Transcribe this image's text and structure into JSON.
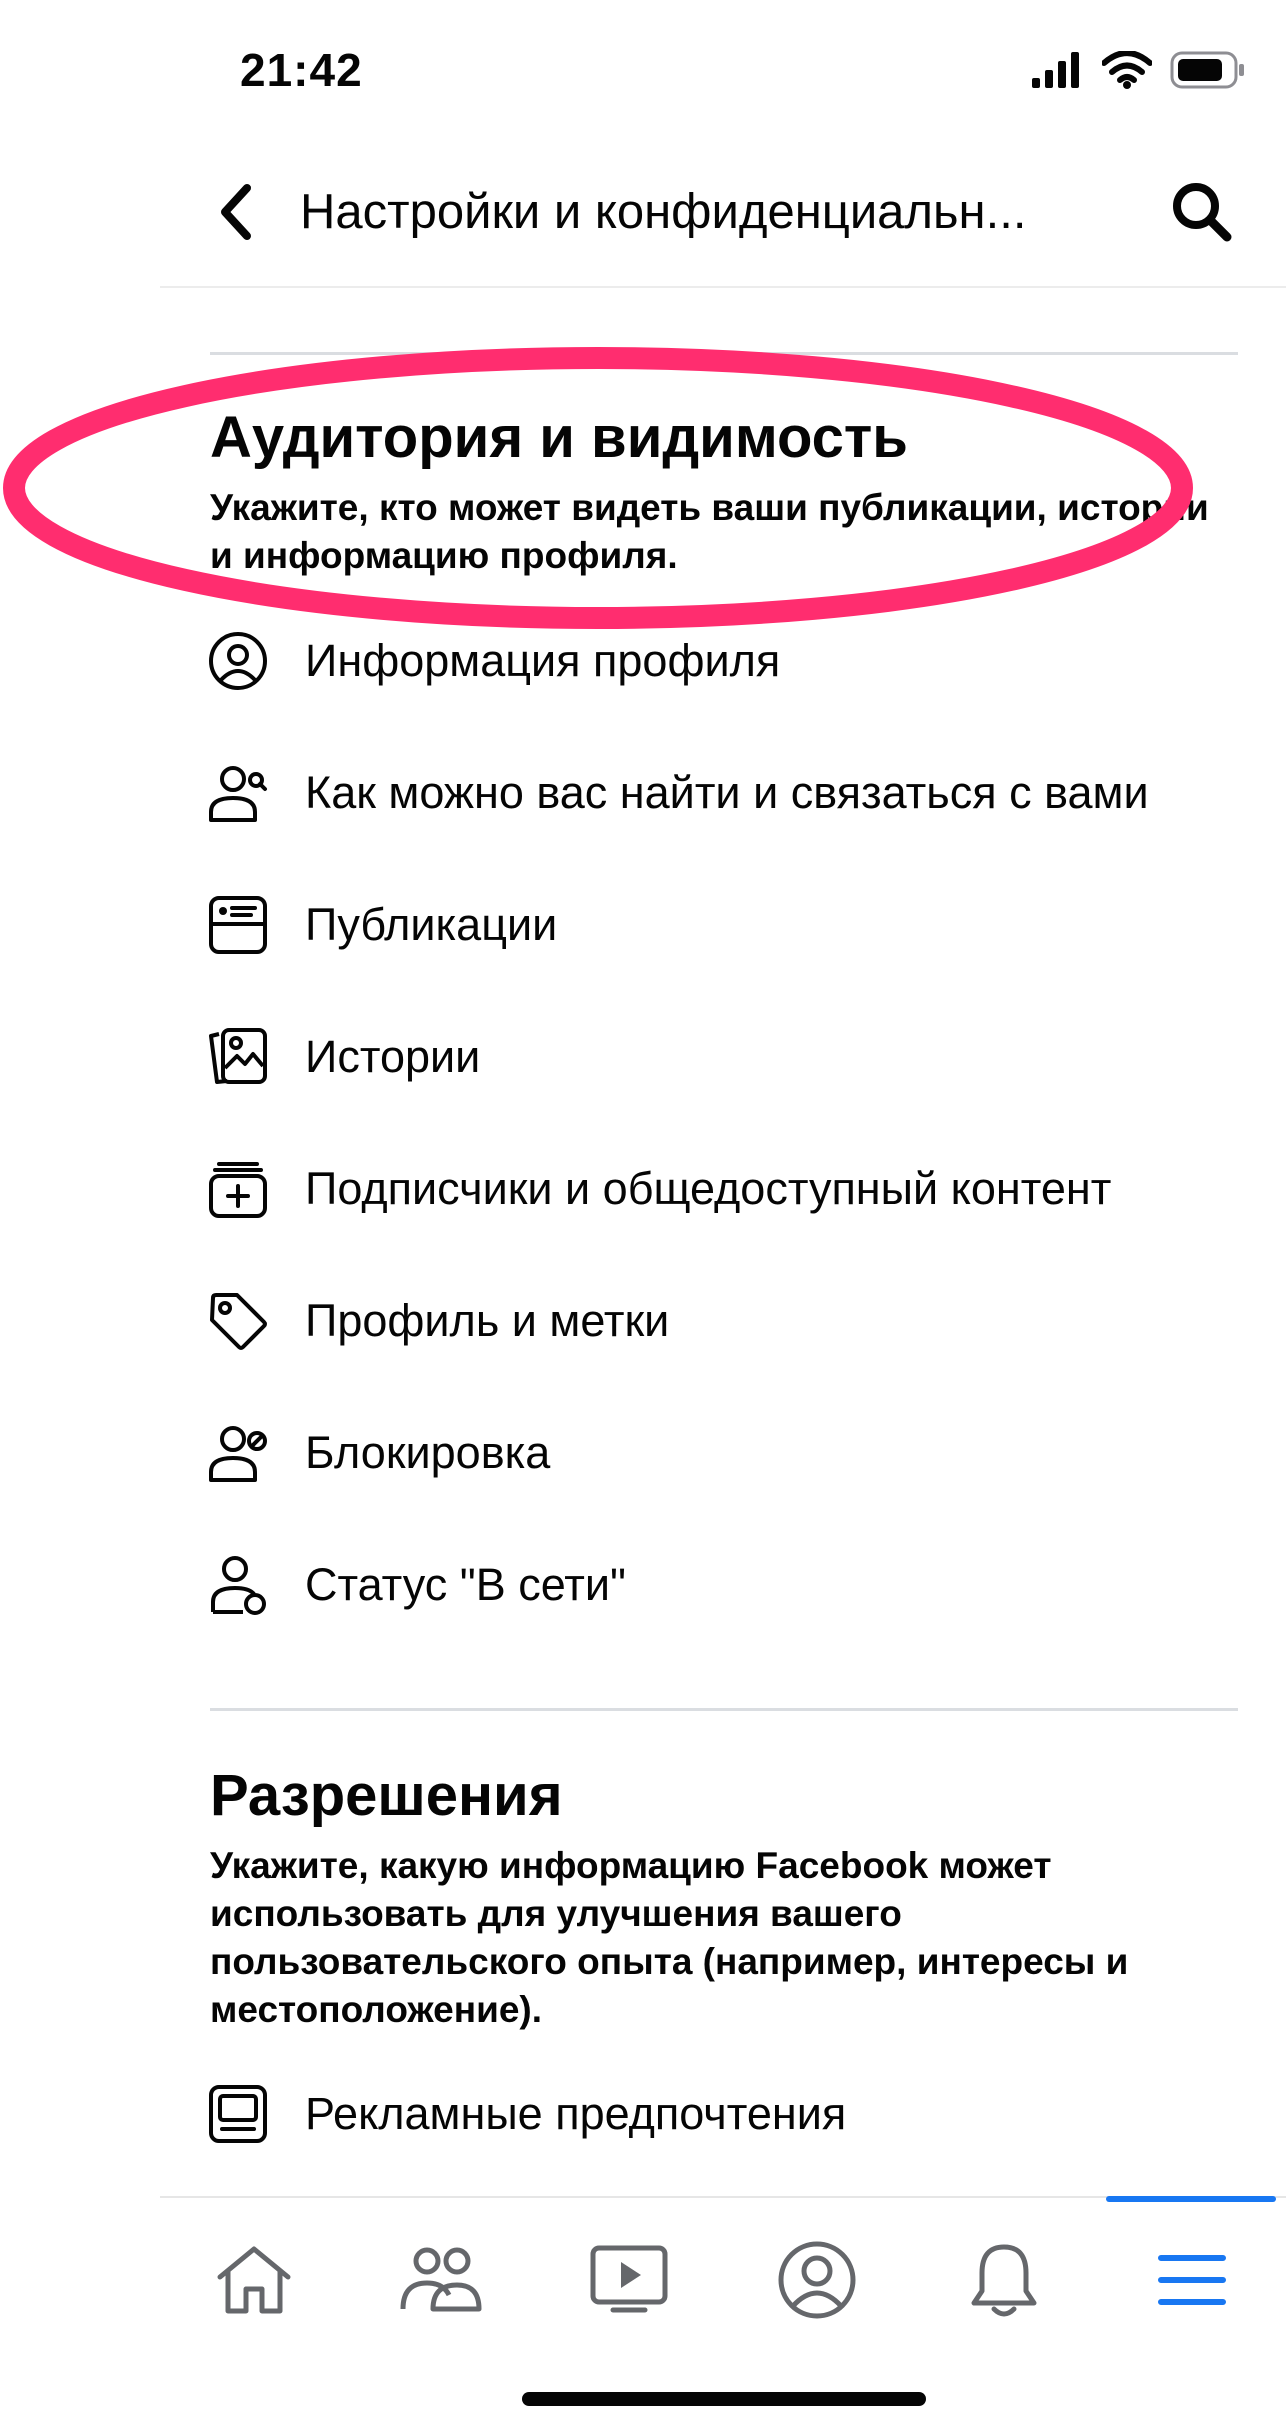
{
  "status_bar": {
    "time": "21:42"
  },
  "header": {
    "title": "Настройки и конфиденциальн..."
  },
  "section_audience": {
    "title": "Аудитория и видимость",
    "description": "Укажите, кто может видеть ваши публикации, истории и информацию профиля.",
    "items": [
      {
        "label": "Информация профиля",
        "icon": "profile-info-icon"
      },
      {
        "label": "Как можно вас найти и связаться с вами",
        "icon": "find-contact-icon"
      },
      {
        "label": "Публикации",
        "icon": "posts-icon"
      },
      {
        "label": "Истории",
        "icon": "stories-icon"
      },
      {
        "label": "Подписчики и общедоступный контент",
        "icon": "followers-icon"
      },
      {
        "label": "Профиль и метки",
        "icon": "tag-icon"
      },
      {
        "label": "Блокировка",
        "icon": "blocking-icon"
      },
      {
        "label": "Статус \"В сети\"",
        "icon": "online-status-icon"
      }
    ]
  },
  "section_permissions": {
    "title": "Разрешения",
    "description": "Укажите, какую информацию Facebook может использовать для улучшения вашего пользовательского опыта (например, интересы и местоположение).",
    "items": [
      {
        "label": "Рекламные предпочтения",
        "icon": "ad-preferences-icon"
      }
    ]
  },
  "bottom_nav": {
    "items": [
      "home-icon",
      "friends-icon",
      "watch-icon",
      "profile-icon",
      "notifications-icon",
      "menu-icon"
    ],
    "active": "menu-icon"
  },
  "colors": {
    "accent": "#1877f2",
    "highlight_ellipse": "#ff2d6f",
    "divider": "#dadde1",
    "icon": "#050505",
    "nav_icon": "#65676b"
  }
}
